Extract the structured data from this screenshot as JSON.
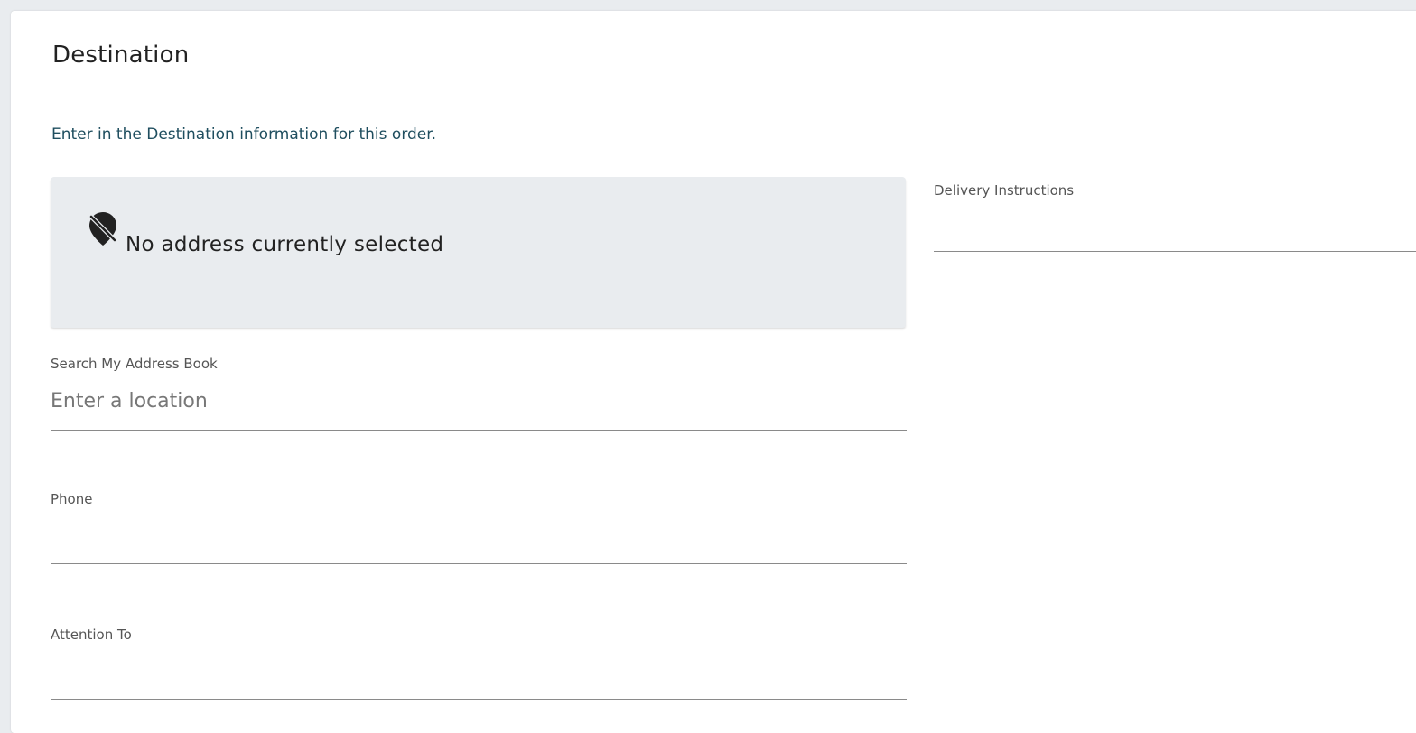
{
  "destination": {
    "title": "Destination",
    "subtitle": "Enter in the Destination information for this order.",
    "address_status": "No address currently selected"
  },
  "fields": {
    "address_search": {
      "label": "Search My Address Book",
      "placeholder": "Enter a location",
      "value": ""
    },
    "phone": {
      "label": "Phone",
      "value": ""
    },
    "attention_to": {
      "label": "Attention To",
      "value": ""
    },
    "delivery_instructions": {
      "label": "Delivery Instructions",
      "value": ""
    }
  },
  "icons": {
    "address_icon": "location-off-icon"
  },
  "colors": {
    "subtitle": "#1f4e5f",
    "panel_bg": "#e9ecef"
  }
}
